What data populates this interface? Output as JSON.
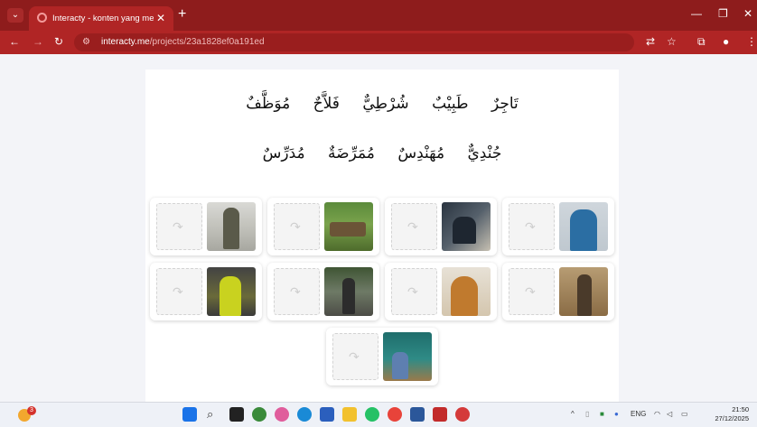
{
  "browser": {
    "tab_title": "Interacty - konten yang menarik",
    "tab_close": "✕",
    "new_tab": "+",
    "url_host": "interacty.me",
    "url_path": "/projects/23a1828ef0a191ed",
    "accent_color": "#b02525"
  },
  "exercise": {
    "words_row1": [
      "تَاجِرٌ",
      "طَبِيْبٌ",
      "شُرْطِيٌّ",
      "فَلاَّحٌ",
      "مُوَظَّفٌ"
    ],
    "words_row2": [
      "جُنْدِيٌّ",
      "مُهَنْدِسٌ",
      "مُمَرِّضَةٌ",
      "مُدَرِّسٌ"
    ],
    "drop_icon": "↷",
    "cards": [
      {
        "image": "soldier"
      },
      {
        "image": "farmer-tractor"
      },
      {
        "image": "engineer-desk"
      },
      {
        "image": "doctor-stethoscope"
      },
      {
        "image": "police-officer"
      },
      {
        "image": "employee-building"
      },
      {
        "image": "nurse"
      },
      {
        "image": "merchant"
      },
      {
        "image": "teacher-classroom"
      }
    ]
  },
  "taskbar": {
    "notification_count": "3",
    "language": "ENG",
    "time": "21:50",
    "date": "27/12/2025"
  }
}
